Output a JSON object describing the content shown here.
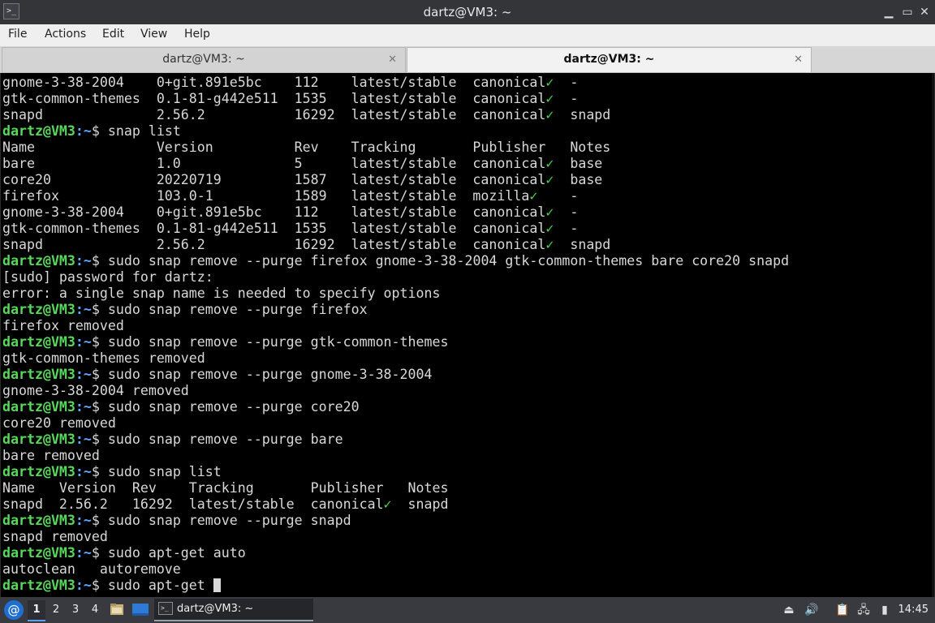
{
  "window": {
    "title": "dartz@VM3: ~",
    "icon": "terminal-icon",
    "controls": {
      "minimize": "▁",
      "maximize": "▭",
      "close": "✕"
    }
  },
  "menu": [
    "File",
    "Actions",
    "Edit",
    "View",
    "Help"
  ],
  "tabs": [
    {
      "label": "dartz@VM3: ~",
      "active": false
    },
    {
      "label": "dartz@VM3: ~",
      "active": true
    }
  ],
  "terminal": {
    "prompt_user": "dartz@VM3",
    "prompt_path": ":~",
    "prompt_symbol": "$ ",
    "lines": [
      {
        "type": "out",
        "text": "gnome-3-38-2004    0+git.891e5bc    112    latest/stable  canonical",
        "check": true,
        "after": "  -"
      },
      {
        "type": "out",
        "text": "gtk-common-themes  0.1-81-g442e511  1535   latest/stable  canonical",
        "check": true,
        "after": "  -"
      },
      {
        "type": "out",
        "text": "snapd              2.56.2           16292  latest/stable  canonical",
        "check": true,
        "after": "  snapd"
      },
      {
        "type": "cmd",
        "text": "snap list"
      },
      {
        "type": "out",
        "text": "Name               Version          Rev    Tracking       Publisher   Notes"
      },
      {
        "type": "out",
        "text": "bare               1.0              5      latest/stable  canonical",
        "check": true,
        "after": "  base"
      },
      {
        "type": "out",
        "text": "core20             20220719         1587   latest/stable  canonical",
        "check": true,
        "after": "  base"
      },
      {
        "type": "out",
        "text": "firefox            103.0-1          1589   latest/stable  mozilla",
        "check": true,
        "after": "    -"
      },
      {
        "type": "out",
        "text": "gnome-3-38-2004    0+git.891e5bc    112    latest/stable  canonical",
        "check": true,
        "after": "  -"
      },
      {
        "type": "out",
        "text": "gtk-common-themes  0.1-81-g442e511  1535   latest/stable  canonical",
        "check": true,
        "after": "  -"
      },
      {
        "type": "out",
        "text": "snapd              2.56.2           16292  latest/stable  canonical",
        "check": true,
        "after": "  snapd"
      },
      {
        "type": "cmd",
        "text": "sudo snap remove --purge firefox gnome-3-38-2004 gtk-common-themes bare core20 snapd"
      },
      {
        "type": "out",
        "text": "[sudo] password for dartz:"
      },
      {
        "type": "out",
        "text": "error: a single snap name is needed to specify options"
      },
      {
        "type": "cmd",
        "text": "sudo snap remove --purge firefox"
      },
      {
        "type": "out",
        "text": "firefox removed"
      },
      {
        "type": "cmd",
        "text": "sudo snap remove --purge gtk-common-themes"
      },
      {
        "type": "out",
        "text": "gtk-common-themes removed"
      },
      {
        "type": "cmd",
        "text": "sudo snap remove --purge gnome-3-38-2004"
      },
      {
        "type": "out",
        "text": "gnome-3-38-2004 removed"
      },
      {
        "type": "cmd",
        "text": "sudo snap remove --purge core20"
      },
      {
        "type": "out",
        "text": "core20 removed"
      },
      {
        "type": "cmd",
        "text": "sudo snap remove --purge bare"
      },
      {
        "type": "out",
        "text": "bare removed"
      },
      {
        "type": "cmd",
        "text": "sudo snap list"
      },
      {
        "type": "out",
        "text": "Name   Version  Rev    Tracking       Publisher   Notes"
      },
      {
        "type": "out",
        "text": "snapd  2.56.2   16292  latest/stable  canonical",
        "check": true,
        "after": "  snapd"
      },
      {
        "type": "cmd",
        "text": "sudo snap remove --purge snapd"
      },
      {
        "type": "out",
        "text": "snapd removed"
      },
      {
        "type": "cmd",
        "text": "sudo apt-get auto"
      },
      {
        "type": "out",
        "text": "autoclean   autoremove"
      },
      {
        "type": "cmd",
        "text": "sudo apt-get ",
        "cursor": true
      }
    ],
    "check_glyph": "✓"
  },
  "taskbar": {
    "start_icon": "debian-logo-icon",
    "workspaces": [
      "1",
      "2",
      "3",
      "4"
    ],
    "active_workspace": 0,
    "task_label": "dartz@VM3: ~",
    "clock": "14:45"
  },
  "colors": {
    "prompt_user": "#57d85a",
    "prompt_path": "#5fa8ff",
    "terminal_bg": "#000000",
    "terminal_fg": "#d8d8d8"
  }
}
